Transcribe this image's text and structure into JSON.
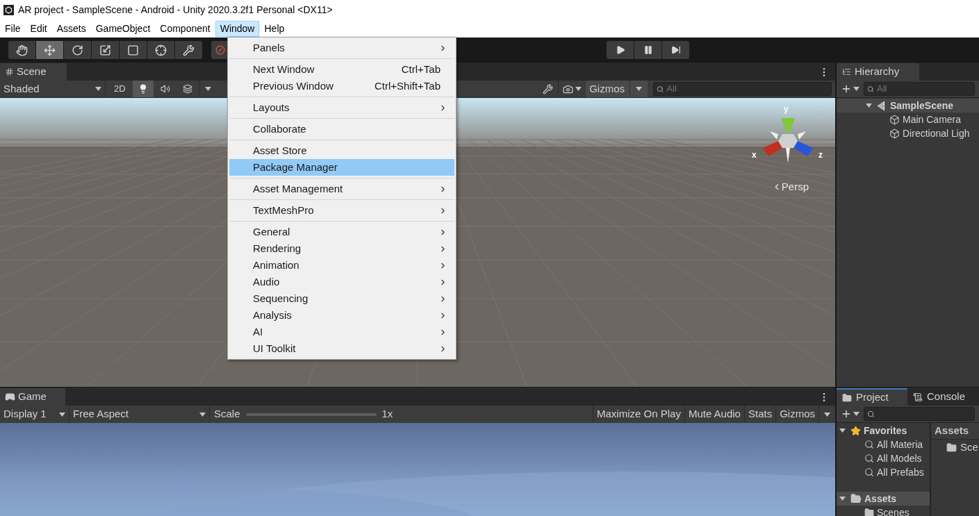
{
  "window": {
    "title": "AR project - SampleScene - Android - Unity 2020.3.2f1 Personal <DX11>"
  },
  "menu_bar": [
    {
      "label": "File",
      "selected": false
    },
    {
      "label": "Edit",
      "selected": false
    },
    {
      "label": "Assets",
      "selected": false
    },
    {
      "label": "GameObject",
      "selected": false
    },
    {
      "label": "Component",
      "selected": false
    },
    {
      "label": "Window",
      "selected": true
    },
    {
      "label": "Help",
      "selected": false
    }
  ],
  "toolbar": {
    "tools": [
      {
        "kind": "hand",
        "selected": false
      },
      {
        "kind": "move",
        "selected": true
      },
      {
        "kind": "rotate",
        "selected": false
      },
      {
        "kind": "scale",
        "selected": false
      },
      {
        "kind": "rect",
        "selected": false
      },
      {
        "kind": "transform",
        "selected": false
      },
      {
        "kind": "custom",
        "selected": false
      },
      {
        "kind": "collab",
        "selected": false
      }
    ],
    "playback": [
      {
        "kind": "play"
      },
      {
        "kind": "pause"
      },
      {
        "kind": "step"
      }
    ]
  },
  "scene": {
    "tab": "Scene",
    "shading": "Shaded",
    "toggles": [
      {
        "kind": "dimension",
        "label": "2D",
        "on": false
      },
      {
        "kind": "light",
        "on": true
      },
      {
        "kind": "audio",
        "on": false
      },
      {
        "kind": "effects",
        "on": false
      }
    ],
    "gizmos": "Gizmos",
    "search": {
      "placeholder": "All"
    },
    "axes": [
      "x",
      "y",
      "z"
    ],
    "projection": "Persp"
  },
  "window_menu": {
    "groups": [
      {
        "items": [
          {
            "label": "Panels",
            "submenu": true,
            "selected": false
          }
        ]
      },
      {
        "items": [
          {
            "label": "Next Window",
            "shortcut": "Ctrl+Tab",
            "submenu": false,
            "selected": false
          },
          {
            "label": "Previous Window",
            "shortcut": "Ctrl+Shift+Tab",
            "submenu": false,
            "selected": false
          }
        ]
      },
      {
        "items": [
          {
            "label": "Layouts",
            "submenu": true,
            "selected": false
          }
        ]
      },
      {
        "items": [
          {
            "label": "Collaborate",
            "submenu": false,
            "selected": false
          }
        ]
      },
      {
        "items": [
          {
            "label": "Asset Store",
            "submenu": false,
            "selected": false
          },
          {
            "label": "Package Manager",
            "submenu": false,
            "selected": true
          }
        ]
      },
      {
        "items": [
          {
            "label": "Asset Management",
            "submenu": true,
            "selected": false
          }
        ]
      },
      {
        "items": [
          {
            "label": "TextMeshPro",
            "submenu": true,
            "selected": false
          }
        ]
      },
      {
        "items": [
          {
            "label": "General",
            "submenu": true,
            "selected": false
          },
          {
            "label": "Rendering",
            "submenu": true,
            "selected": false
          },
          {
            "label": "Animation",
            "submenu": true,
            "selected": false
          },
          {
            "label": "Audio",
            "submenu": true,
            "selected": false
          },
          {
            "label": "Sequencing",
            "submenu": true,
            "selected": false
          },
          {
            "label": "Analysis",
            "submenu": true,
            "selected": false
          },
          {
            "label": "AI",
            "submenu": true,
            "selected": false
          },
          {
            "label": "UI Toolkit",
            "submenu": true,
            "selected": false
          }
        ]
      }
    ]
  },
  "game": {
    "tab": "Game",
    "display": "Display 1",
    "aspect": "Free Aspect",
    "scale_label": "Scale",
    "scale_value": "1x",
    "buttons": [
      "Maximize On Play",
      "Mute Audio",
      "Stats",
      "Gizmos"
    ]
  },
  "hierarchy": {
    "tab": "Hierarchy",
    "search": {
      "placeholder": "All"
    },
    "tree": [
      {
        "label": "SampleScene",
        "expanded": true,
        "selected": true,
        "children": [
          {
            "label": "Main Camera"
          },
          {
            "label": "Directional Ligh"
          }
        ]
      }
    ]
  },
  "project": {
    "tabs": [
      {
        "label": "Project",
        "selected": true
      },
      {
        "label": "Console",
        "selected": false
      }
    ],
    "tree": [
      {
        "label": "Favorites",
        "kind": "favorites",
        "expanded": true,
        "selected": false,
        "children": [
          {
            "label": "All Materia"
          },
          {
            "label": "All Models"
          },
          {
            "label": "All Prefabs"
          }
        ]
      },
      {
        "label": "Assets",
        "kind": "folder",
        "expanded": true,
        "selected": true,
        "children": [
          {
            "label": "Scenes"
          }
        ]
      }
    ],
    "breadcrumb": "Assets",
    "items": [
      {
        "label": "Sce"
      }
    ]
  }
}
